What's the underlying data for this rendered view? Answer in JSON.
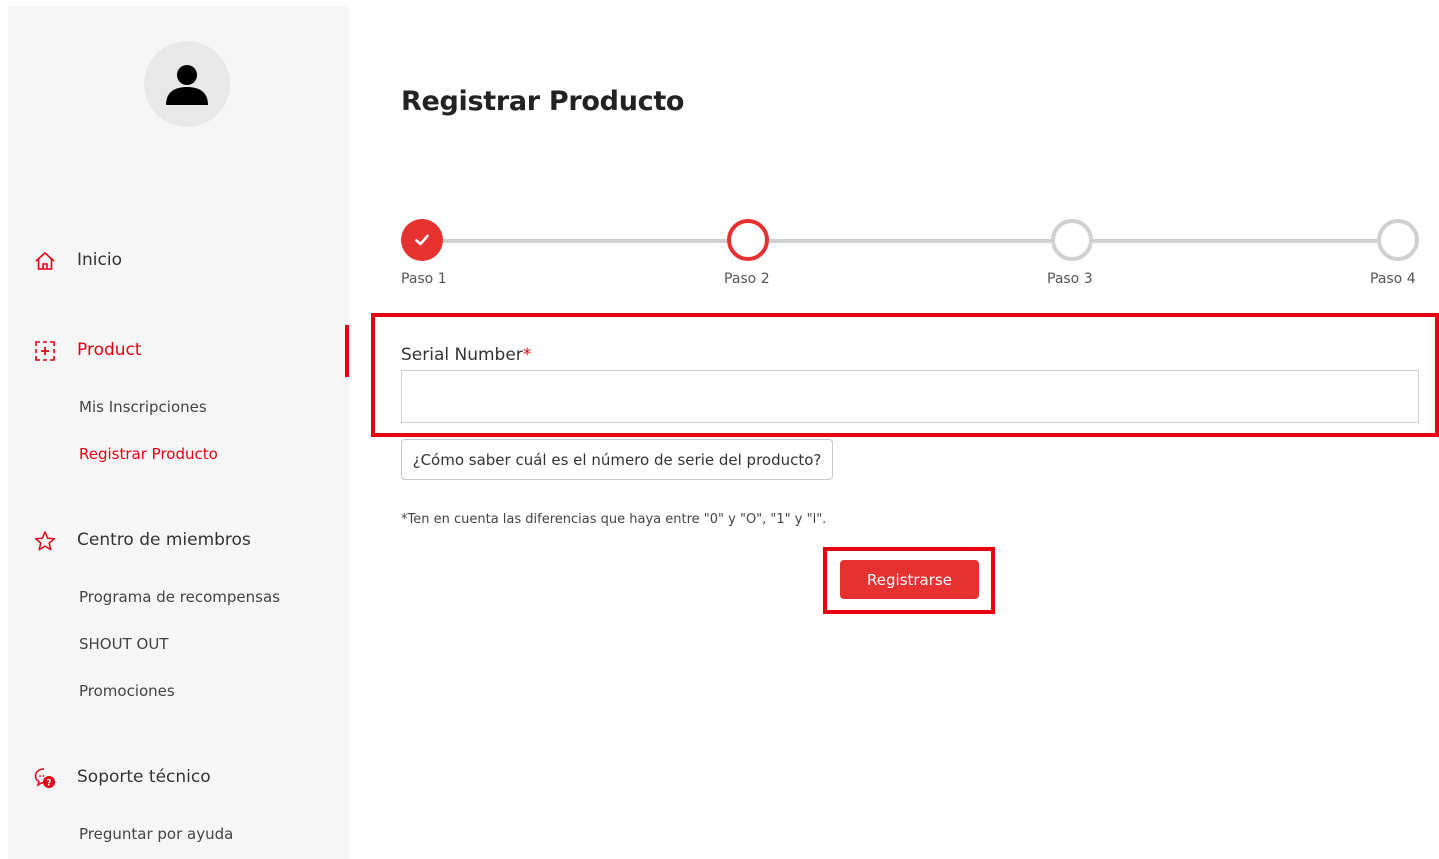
{
  "sidebar": {
    "nav": [
      {
        "label": "Inicio",
        "icon": "home-icon"
      },
      {
        "label": "Product",
        "icon": "product-add-icon",
        "active": true
      },
      {
        "label": "Centro de miembros",
        "icon": "star-icon"
      },
      {
        "label": "Soporte técnico",
        "icon": "support-chat-icon"
      }
    ],
    "product_sub": [
      "Mis Inscripciones",
      "Registrar Producto"
    ],
    "members_sub": [
      "Programa de recompensas",
      "SHOUT OUT",
      "Promociones"
    ],
    "support_sub": [
      "Preguntar por ayuda"
    ]
  },
  "main": {
    "title": "Registrar Producto",
    "steps": [
      "Paso 1",
      "Paso 2",
      "Paso 3",
      "Paso 4"
    ],
    "current_step": 2,
    "serial_label": "Serial Number",
    "required_mark": "*",
    "serial_value": "",
    "help_button": "¿Cómo saber cuál es el número de serie del producto?",
    "note": "*Ten en cuenta las diferencias que haya entre \"0\" y \"O\", \"1\" y \"l\".",
    "register_button": "Registrarse"
  },
  "colors": {
    "accent": "#e60012",
    "step_active": "#e63131",
    "step_inactive": "#d0d0d0",
    "sidebar_bg": "#f6f6f6"
  }
}
